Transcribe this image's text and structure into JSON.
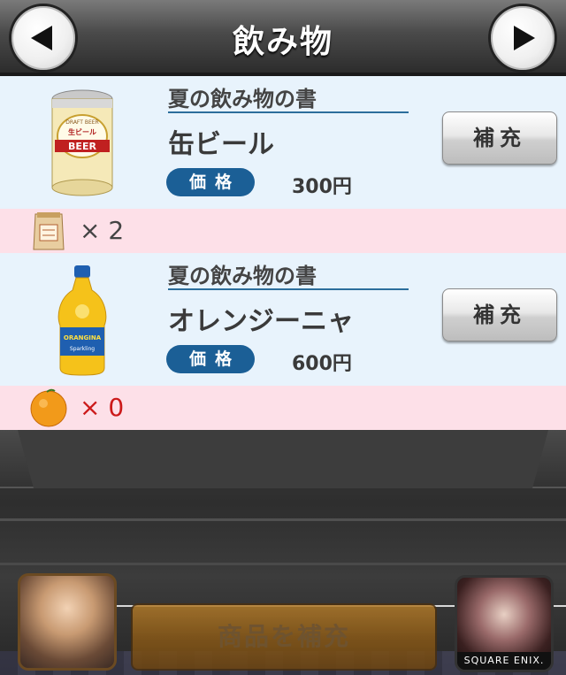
{
  "header": {
    "title": "飲み物",
    "prev_icon": "left-triangle-icon",
    "next_icon": "right-triangle-icon"
  },
  "products": [
    {
      "book": "夏の飲み物の書",
      "name": "缶ビール",
      "price_label": "価格",
      "price": "300円",
      "refill_label": "補充",
      "image_icon": "beer-can-icon",
      "ingredient_icon": "grain-sack-icon",
      "stock": "× 2"
    },
    {
      "book": "夏の飲み物の書",
      "name": "オレンジーニャ",
      "price_label": "価格",
      "price": "600円",
      "refill_label": "補充",
      "image_icon": "orange-soda-bottle-icon",
      "ingredient_icon": "orange-icon",
      "stock": "× 0"
    }
  ],
  "beer_can_labels": {
    "top": "DRAFT BEER",
    "middle": "生ビール",
    "band": "BEER"
  },
  "bottle_labels": {
    "brand": "ORANGINA",
    "sub": "Sparkling"
  },
  "footer": {
    "refill_all_label": "商品を補充",
    "brand": "SQUARE ENIX."
  },
  "colors": {
    "header_text": "#ffffff",
    "card_bg": "#e8f3fc",
    "stock_bg": "#fde0e8",
    "price_badge": "#1b5f96",
    "zero_stock": "#cc1a1a"
  }
}
